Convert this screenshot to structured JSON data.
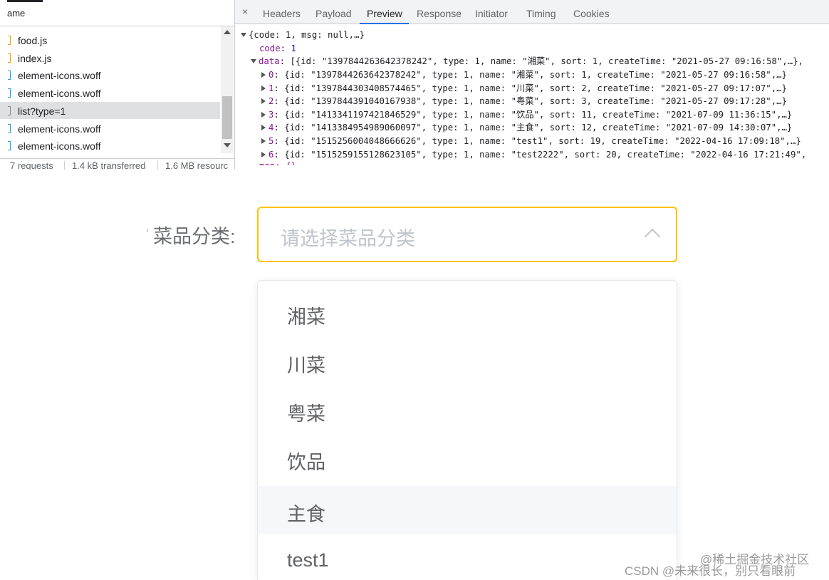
{
  "network": {
    "column_header": "ame",
    "requests": [
      {
        "name": "food.js",
        "kind": "js",
        "selected": false
      },
      {
        "name": "index.js",
        "kind": "js",
        "selected": false
      },
      {
        "name": "element-icons.woff",
        "kind": "font",
        "selected": false
      },
      {
        "name": "element-icons.woff",
        "kind": "font",
        "selected": false
      },
      {
        "name": "list?type=1",
        "kind": "doc",
        "selected": true
      },
      {
        "name": "element-icons.woff",
        "kind": "font",
        "selected": false
      },
      {
        "name": "element-icons.woff",
        "kind": "font",
        "selected": false
      }
    ],
    "status": {
      "requests": "7 requests",
      "transferred": "1.4 kB transferred",
      "resources": "1.6 MB resourc"
    }
  },
  "preview": {
    "close": "×",
    "tabs": [
      {
        "label": "Headers",
        "active": false
      },
      {
        "label": "Payload",
        "active": false
      },
      {
        "label": "Preview",
        "active": true
      },
      {
        "label": "Response",
        "active": false
      },
      {
        "label": "Initiator",
        "active": false
      },
      {
        "label": "Timing",
        "active": false
      },
      {
        "label": "Cookies",
        "active": false
      }
    ],
    "json": {
      "root": "{code: 1, msg: null,…}",
      "code_key": "code",
      "code_val": "1",
      "data_key": "data",
      "data_summary": "[{id: \"1397844263642378242\", type: 1, name: \"湘菜\", sort: 1, createTime: \"2021-05-27 09:16:58\",…},",
      "items": [
        {
          "idx": "0",
          "text": "{id: \"1397844263642378242\", type: 1, name: \"湘菜\", sort: 1, createTime: \"2021-05-27 09:16:58\",…}"
        },
        {
          "idx": "1",
          "text": "{id: \"1397844303408574465\", type: 1, name: \"川菜\", sort: 2, createTime: \"2021-05-27 09:17:07\",…}"
        },
        {
          "idx": "2",
          "text": "{id: \"1397844391040167938\", type: 1, name: \"粤菜\", sort: 3, createTime: \"2021-05-27 09:17:28\",…}"
        },
        {
          "idx": "3",
          "text": "{id: \"1413341197421846529\", type: 1, name: \"饮品\", sort: 11, createTime: \"2021-07-09 11:36:15\",…}"
        },
        {
          "idx": "4",
          "text": "{id: \"1413384954989060097\", type: 1, name: \"主食\", sort: 12, createTime: \"2021-07-09 14:30:07\",…}"
        },
        {
          "idx": "5",
          "text": "{id: \"1515256004048666626\", type: 1, name: \"test1\", sort: 19, createTime: \"2022-04-16 17:09:18\",…}"
        },
        {
          "idx": "6",
          "text": "{id: \"1515259155128623105\", type: 1, name: \"test2222\", sort: 20, createTime: \"2022-04-16 17:21:49\","
        }
      ],
      "map_partial": "map: {}"
    }
  },
  "form": {
    "label": "菜品分类:",
    "placeholder": "请选择菜品分类",
    "options": [
      {
        "label": "湘菜",
        "hover": false
      },
      {
        "label": "川菜",
        "hover": false
      },
      {
        "label": "粤菜",
        "hover": false
      },
      {
        "label": "饮品",
        "hover": false
      },
      {
        "label": "主食",
        "hover": true
      },
      {
        "label": "test1",
        "hover": false
      }
    ]
  },
  "watermarks": {
    "juejin": "@稀土掘金技术社区",
    "csdn": "CSDN @未来很长，别只看眼前"
  },
  "colors": {
    "select_border": "#ffc200",
    "devtools_tab_active": "#1a73e8",
    "json_key": "#881391",
    "json_number": "#1a1aa6"
  }
}
